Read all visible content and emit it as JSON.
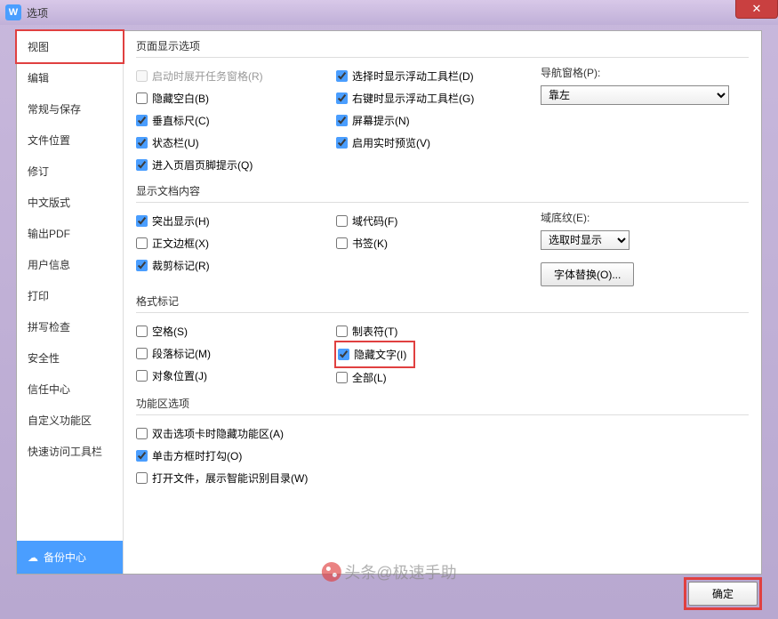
{
  "title": "选项",
  "sidebar": {
    "items": [
      "视图",
      "编辑",
      "常规与保存",
      "文件位置",
      "修订",
      "中文版式",
      "输出PDF",
      "用户信息",
      "打印",
      "拼写检查",
      "安全性",
      "信任中心",
      "自定义功能区",
      "快速访问工具栏"
    ],
    "backup": "备份中心"
  },
  "groups": {
    "page": {
      "title": "页面显示选项",
      "c1": [
        "启动时展开任务窗格(R)",
        "隐藏空白(B)",
        "垂直标尺(C)",
        "状态栏(U)",
        "进入页眉页脚提示(Q)"
      ],
      "c2": [
        "选择时显示浮动工具栏(D)",
        "右键时显示浮动工具栏(G)",
        "屏幕提示(N)",
        "启用实时预览(V)"
      ],
      "navLabel": "导航窗格(P):",
      "navVal": "靠左"
    },
    "doc": {
      "title": "显示文档内容",
      "c1": [
        "突出显示(H)",
        "正文边框(X)",
        "裁剪标记(R)"
      ],
      "c2": [
        "域代码(F)",
        "书签(K)"
      ],
      "shadeLabel": "域底纹(E):",
      "shadeVal": "选取时显示",
      "fontBtn": "字体替换(O)..."
    },
    "fmt": {
      "title": "格式标记",
      "c1": [
        "空格(S)",
        "段落标记(M)",
        "对象位置(J)"
      ],
      "c2": [
        "制表符(T)",
        "隐藏文字(I)",
        "全部(L)"
      ]
    },
    "ribbon": {
      "title": "功能区选项",
      "items": [
        "双击选项卡时隐藏功能区(A)",
        "单击方框时打勾(O)",
        "打开文件，展示智能识别目录(W)"
      ]
    }
  },
  "okBtn": "确定",
  "watermark": "头条@极速手助"
}
